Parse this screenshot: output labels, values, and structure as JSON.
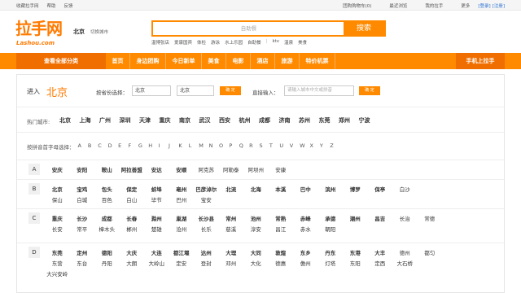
{
  "topbar": {
    "left": [
      "收藏拉手网",
      "帮助",
      "反馈"
    ],
    "right": [
      "团购购物车(0)",
      "最近浏览",
      "我的拉手",
      "更多"
    ],
    "login": "[登录]",
    "register": "[注册]"
  },
  "header": {
    "logo_cn": "拉手网",
    "logo_en": "Lashou.com",
    "city": "北京",
    "switch_city": "切换城市",
    "search_placeholder": "自助餐",
    "search_button": "搜索",
    "hot_words": [
      "温博张店",
      "爱康国宾",
      "体检",
      "游泳",
      "水上乐园",
      "自助餐",
      "ktv",
      "温泉",
      "美食"
    ]
  },
  "nav": {
    "all_categories": "查看全部分类",
    "items": [
      "首页",
      "身边团购",
      "今日新单",
      "美食",
      "电影",
      "酒店",
      "旅游",
      "特价机票"
    ],
    "mobile": "手机上拉手"
  },
  "selector": {
    "enter_label": "进入",
    "current_city": "北京",
    "province_label": "按省份选择：",
    "province_value": "北京",
    "city_value": "北京",
    "confirm": "确 定",
    "direct_label": "直接输入：",
    "direct_placeholder": "请输入城市中文或拼音",
    "confirm2": "确 定"
  },
  "hot_cities": {
    "label": "热门城市:",
    "list": [
      "北京",
      "上海",
      "广州",
      "深圳",
      "天津",
      "重庆",
      "南京",
      "武汉",
      "西安",
      "杭州",
      "成都",
      "济南",
      "苏州",
      "东莞",
      "郑州",
      "宁波"
    ]
  },
  "letters": {
    "label": "按拼音首字母选择：",
    "list": [
      "A",
      "B",
      "C",
      "D",
      "E",
      "F",
      "G",
      "H",
      "I",
      "J",
      "K",
      "L",
      "M",
      "N",
      "O",
      "P",
      "Q",
      "R",
      "S",
      "T",
      "U",
      "V",
      "W",
      "X",
      "Y",
      "Z"
    ]
  },
  "groups": [
    {
      "letter": "A",
      "rows": [
        [
          "安庆",
          "安阳",
          "鞍山",
          "阿拉善盟",
          "安达",
          "安顺",
          "阿克苏",
          "阿勒泰",
          "阿坝州",
          "安康"
        ]
      ]
    },
    {
      "letter": "B",
      "rows": [
        [
          "北京",
          "宝鸡",
          "包头",
          "保定",
          "蚌埠",
          "亳州",
          "巴彦淖尔",
          "北流",
          "北海",
          "本溪",
          "巴中",
          "滨州",
          "博罗",
          "保亭",
          "白沙"
        ],
        [
          "保山",
          "白城",
          "百色",
          "白山",
          "毕节",
          "巴州",
          "宝安"
        ]
      ]
    },
    {
      "letter": "C",
      "rows": [
        [
          "重庆",
          "长沙",
          "成都",
          "长春",
          "滁州",
          "巢湖",
          "长沙县",
          "常州",
          "池州",
          "常熟",
          "赤峰",
          "承德",
          "潮州",
          "昌吉",
          "长治",
          "常德"
        ],
        [
          "长安",
          "常平",
          "樟木头",
          "郴州",
          "楚雄",
          "沧州",
          "长乐",
          "慈溪",
          "淳安",
          "昌江",
          "赤水",
          "朝阳"
        ]
      ]
    },
    {
      "letter": "D",
      "rows": [
        [
          "东莞",
          "定州",
          "德阳",
          "大庆",
          "大连",
          "都江堰",
          "达州",
          "大理",
          "大同",
          "敦煌",
          "东乡",
          "丹东",
          "东港",
          "大丰",
          "德州",
          "都匀"
        ],
        [
          "东营",
          "东台",
          "丹阳",
          "大朗",
          "大岭山",
          "定安",
          "登封",
          "邓州",
          "大化",
          "德惠",
          "儋州",
          "灯塔",
          "东阳",
          "定西",
          "大石桥"
        ],
        [
          "大兴安岭"
        ]
      ]
    }
  ]
}
